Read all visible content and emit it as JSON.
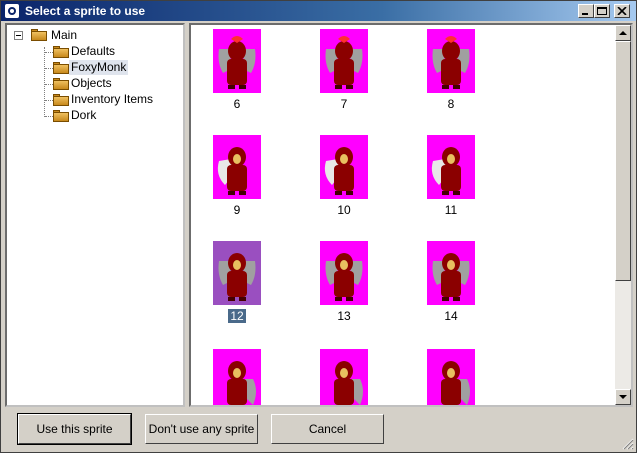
{
  "window": {
    "title": "Select a sprite to use"
  },
  "tree": {
    "root": "Main",
    "items": [
      {
        "label": "Defaults",
        "selected": false
      },
      {
        "label": "FoxyMonk",
        "selected": true
      },
      {
        "label": "Objects",
        "selected": false
      },
      {
        "label": "Inventory Items",
        "selected": false
      },
      {
        "label": "Dork",
        "selected": false
      }
    ]
  },
  "sprites": [
    {
      "number": "6",
      "pose": "back",
      "selected": false
    },
    {
      "number": "7",
      "pose": "back",
      "selected": false
    },
    {
      "number": "8",
      "pose": "back",
      "selected": false
    },
    {
      "number": "9",
      "pose": "left",
      "selected": false
    },
    {
      "number": "10",
      "pose": "left",
      "selected": false
    },
    {
      "number": "11",
      "pose": "left",
      "selected": false
    },
    {
      "number": "12",
      "pose": "front",
      "selected": true
    },
    {
      "number": "13",
      "pose": "front",
      "selected": false
    },
    {
      "number": "14",
      "pose": "front",
      "selected": false
    },
    {
      "number": "",
      "pose": "right",
      "selected": false
    },
    {
      "number": "",
      "pose": "right",
      "selected": false
    },
    {
      "number": "",
      "pose": "right",
      "selected": false
    }
  ],
  "buttons": {
    "use": "Use this sprite",
    "none": "Don't use any sprite",
    "cancel": "Cancel"
  },
  "colors": {
    "sprite_bg": "#ff00ff",
    "sprite_selected_bg": "#9a4fc0",
    "robe": "#8b0000",
    "wing": "#a0a0a0"
  }
}
